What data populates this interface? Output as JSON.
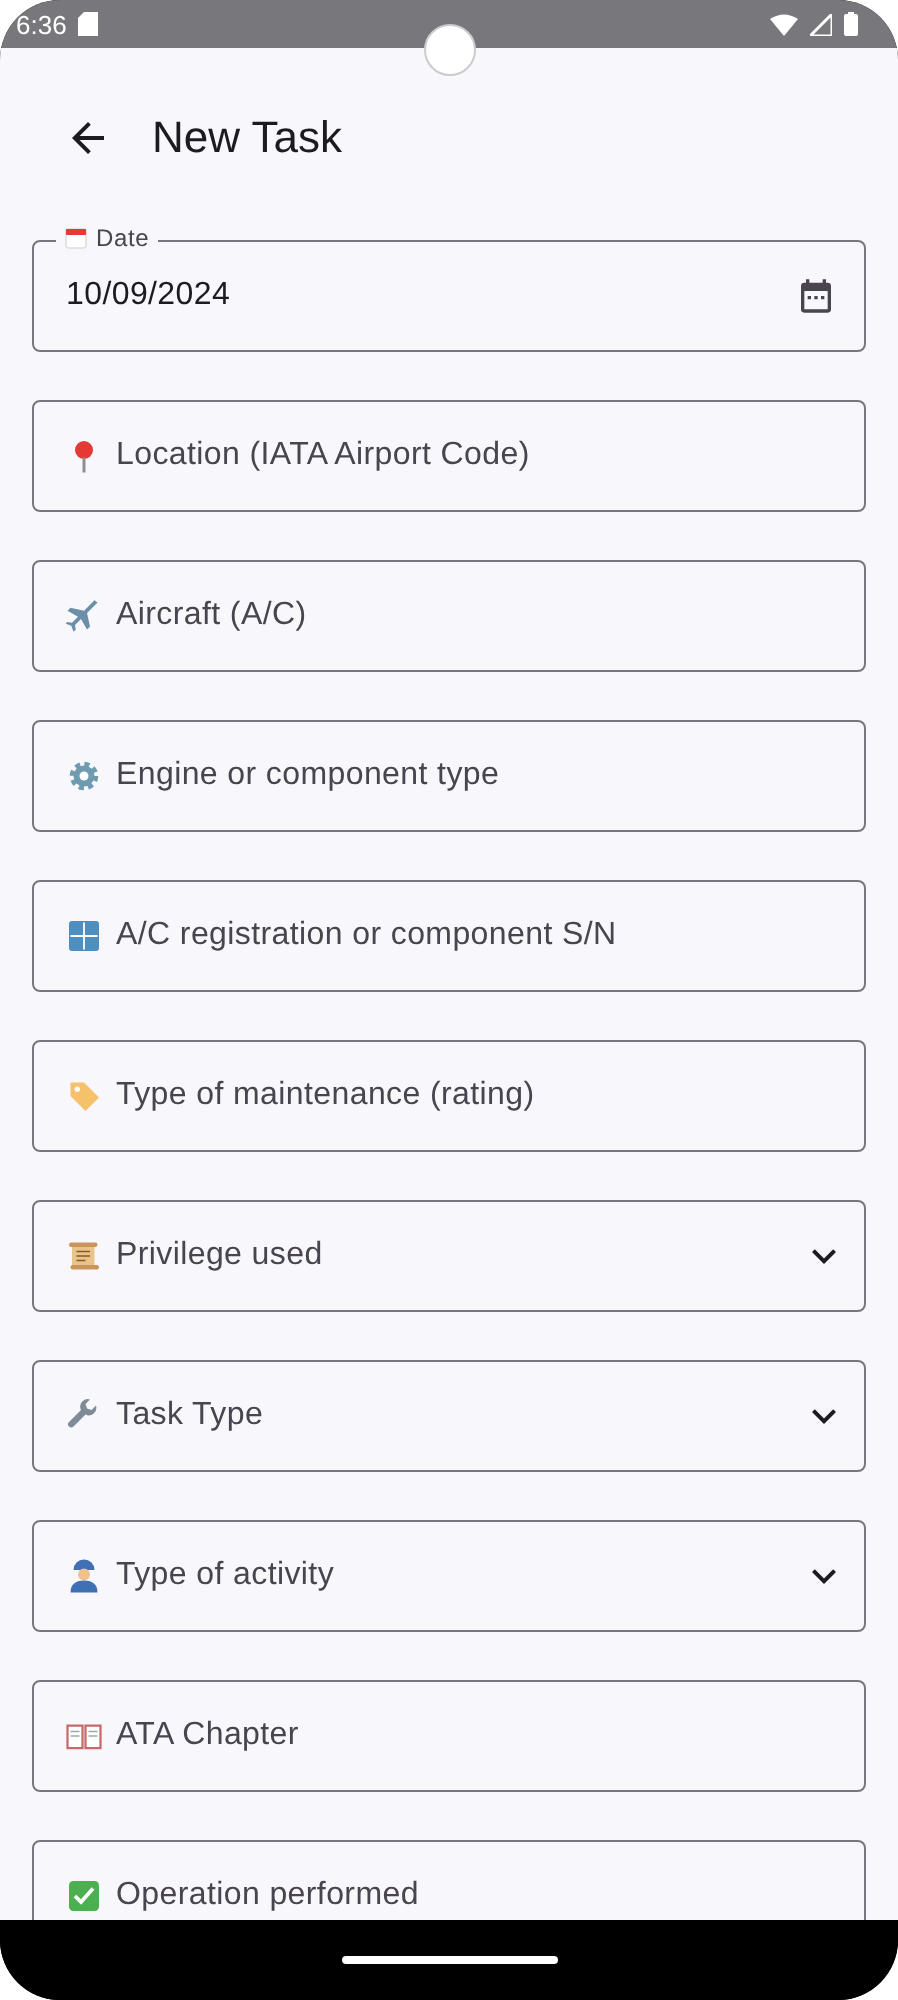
{
  "status_bar": {
    "time": "6:36"
  },
  "header": {
    "title": "New Task"
  },
  "date_field": {
    "label": "Date",
    "value": "10/09/2024"
  },
  "fields": [
    {
      "kind": "text",
      "placeholder": "Location (IATA Airport Code)"
    },
    {
      "kind": "text",
      "placeholder": "Aircraft (A/C)"
    },
    {
      "kind": "text",
      "placeholder": "Engine or component type"
    },
    {
      "kind": "text",
      "placeholder": "A/C registration or component S/N"
    },
    {
      "kind": "text",
      "placeholder": "Type of maintenance (rating)"
    },
    {
      "kind": "dropdown",
      "label": "Privilege used"
    },
    {
      "kind": "dropdown",
      "label": "Task Type"
    },
    {
      "kind": "dropdown",
      "label": "Type of activity"
    },
    {
      "kind": "text",
      "placeholder": "ATA Chapter"
    },
    {
      "kind": "text",
      "placeholder": "Operation performed"
    }
  ]
}
